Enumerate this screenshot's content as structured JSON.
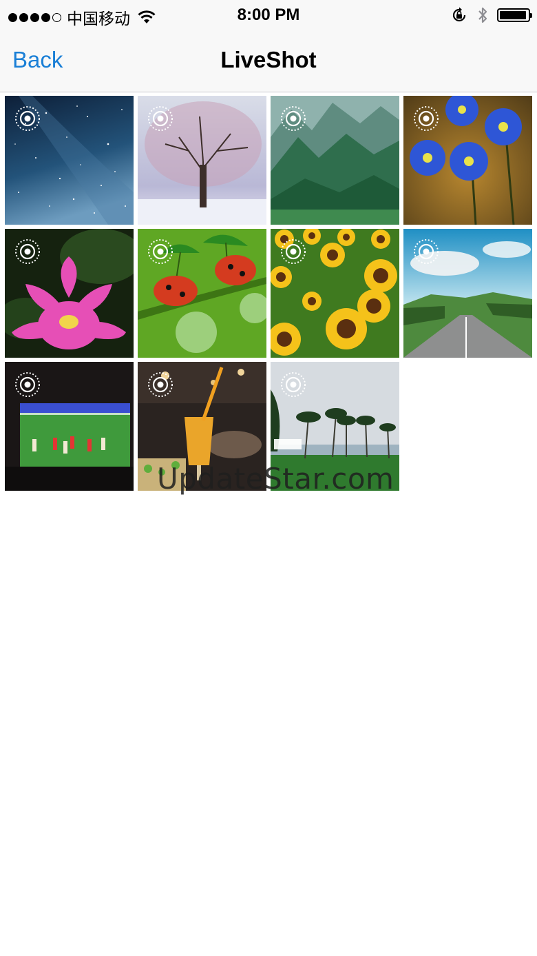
{
  "status_bar": {
    "carrier": "中国移动",
    "time": "8:00 PM",
    "signal_bars_filled": 4,
    "signal_bars_total": 5,
    "icons": [
      "wifi-icon",
      "rotation-lock-icon",
      "bluetooth-icon",
      "battery-icon"
    ],
    "battery_level": 0.95
  },
  "nav": {
    "back_label": "Back",
    "title": "LiveShot"
  },
  "photos": [
    {
      "subject": "starry-sky",
      "live": true
    },
    {
      "subject": "snowy-tree",
      "live": true
    },
    {
      "subject": "misty-mountains",
      "live": true
    },
    {
      "subject": "blue-flowers",
      "live": true
    },
    {
      "subject": "pink-lotus",
      "live": true
    },
    {
      "subject": "ladybugs",
      "live": true
    },
    {
      "subject": "sunflowers",
      "live": true
    },
    {
      "subject": "country-road",
      "live": true
    },
    {
      "subject": "soccer-tv",
      "live": true
    },
    {
      "subject": "juice-drink",
      "live": true
    },
    {
      "subject": "palm-beach",
      "live": true
    }
  ],
  "watermark": "UpdateStar.com",
  "colors": {
    "accent": "#1a7fd6",
    "nav_background": "#f8f8f8",
    "separator": "#c8c7cc"
  }
}
